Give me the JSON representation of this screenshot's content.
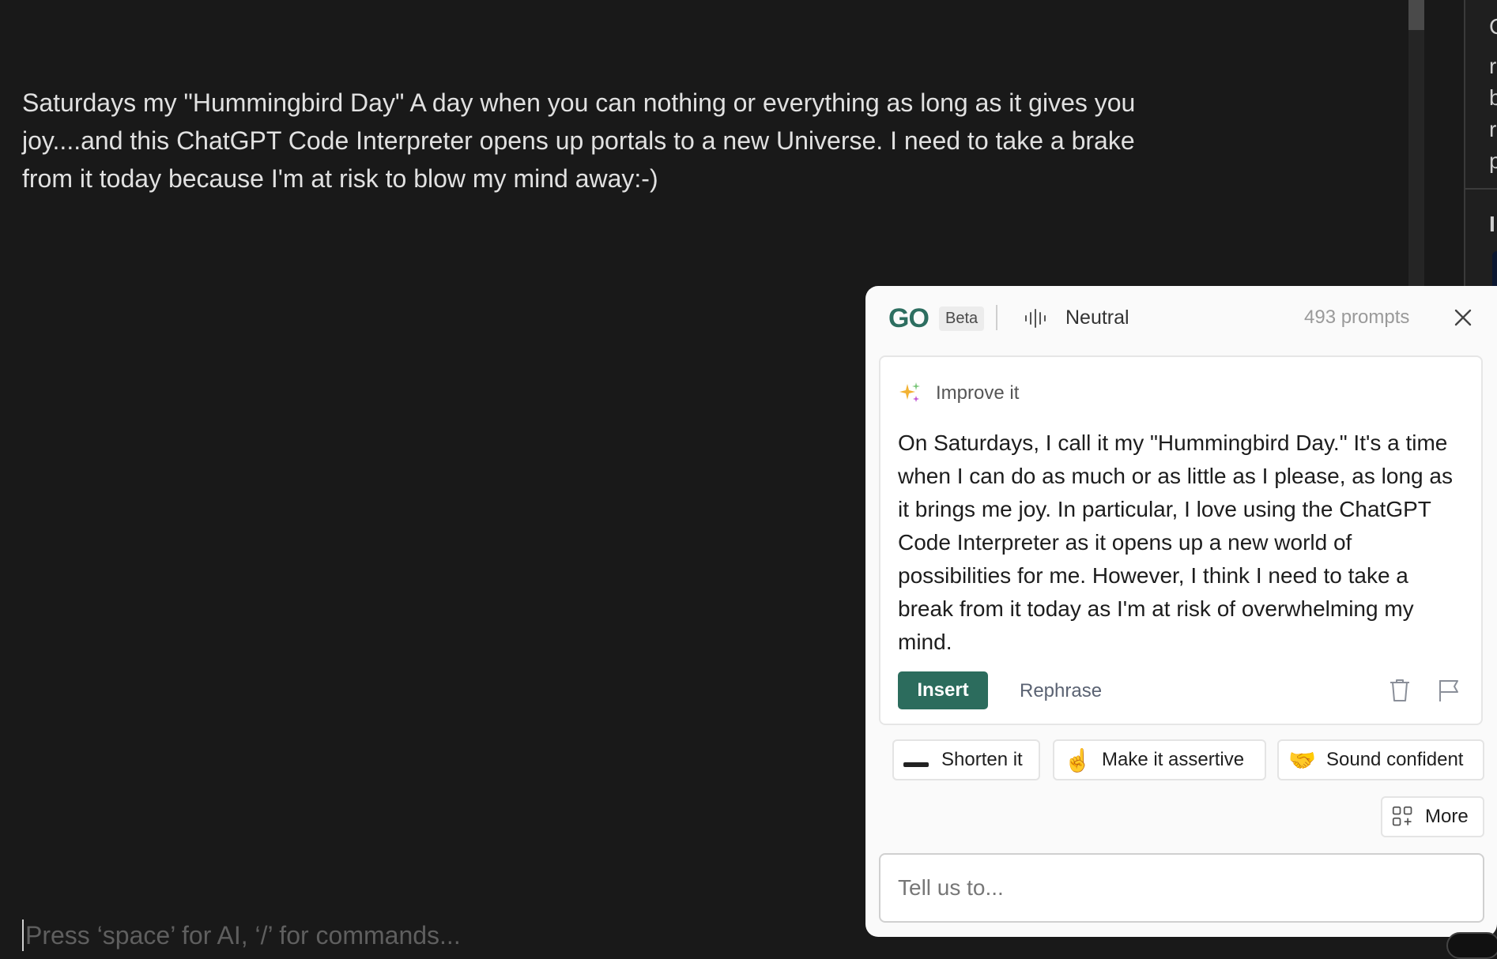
{
  "editor": {
    "body_text": "Saturdays my \"Hummingbird Day\" A day when you can nothing or everything as long as it gives you joy....and this ChatGPT Code Interpreter opens up portals to a new Universe. I need to take a brake from it today because I'm at risk to blow my mind away:-)",
    "placeholder": "Press ‘space’ for AI, ‘/’ for commands..."
  },
  "side_panel": {
    "peek_letters": [
      "C",
      "r",
      "b",
      "r",
      "p",
      "I"
    ]
  },
  "assistant": {
    "logo": "GO",
    "badge": "Beta",
    "tone": "Neutral",
    "prompts": "493 prompts",
    "card": {
      "heading": "Improve it",
      "suggestion": "On Saturdays, I call it my \"Hummingbird Day.\" It's a time when I can do as much or as little as I please, as long as it brings me joy. In particular, I love using the ChatGPT Code Interpreter as it opens up a new world of possibilities for me. However, I think I need to take a break from it today as I'm at risk of overwhelming my mind.",
      "insert_label": "Insert",
      "rephrase_label": "Rephrase"
    },
    "chips": {
      "shorten": {
        "label": "Shorten it",
        "icon": "dash-icon"
      },
      "assertive": {
        "label": "Make it assertive",
        "icon": "☝️"
      },
      "confident": {
        "label": "Sound confident",
        "icon": "🤝"
      },
      "more": {
        "label": "More",
        "icon": "apps-plus-icon"
      }
    },
    "input_placeholder": "Tell us to..."
  },
  "colors": {
    "brand": "#2d6e60",
    "insert_bg": "#2c6c5d",
    "editor_bg": "#191919"
  }
}
